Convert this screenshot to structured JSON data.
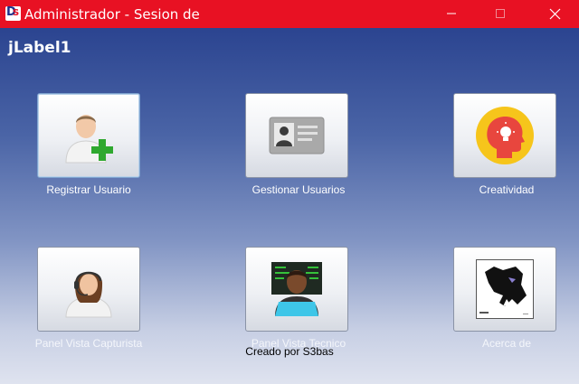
{
  "window": {
    "title": "Administrador - Sesion de",
    "icon": "app-logo-icon",
    "controls": [
      "minimize-icon",
      "maximize-icon",
      "close-icon"
    ]
  },
  "header": {
    "label": "jLabel1"
  },
  "tiles": [
    {
      "label": "Registrar Usuario",
      "icon": "add-user-icon"
    },
    {
      "label": "Gestionar Usuarios",
      "icon": "id-card-icon"
    },
    {
      "label": "Creatividad",
      "icon": "creativity-head-icon"
    },
    {
      "label": "Panel Vista Capturista",
      "icon": "operator-headset-icon"
    },
    {
      "label": "Panel Vista Tecnico",
      "icon": "technician-laptop-icon"
    },
    {
      "label": "Acerca de",
      "icon": "panther-logo-icon"
    }
  ],
  "footer": {
    "text": "Creado por S3bas"
  },
  "colors": {
    "titlebar": "#e81123",
    "background_top": "#2b4490",
    "background_bottom": "#dfe3ef",
    "plus_green": "#2fa82f",
    "creativity_yellow": "#f6c51b",
    "creativity_red": "#e8463e",
    "screen_cyan": "#3ec6e8"
  }
}
